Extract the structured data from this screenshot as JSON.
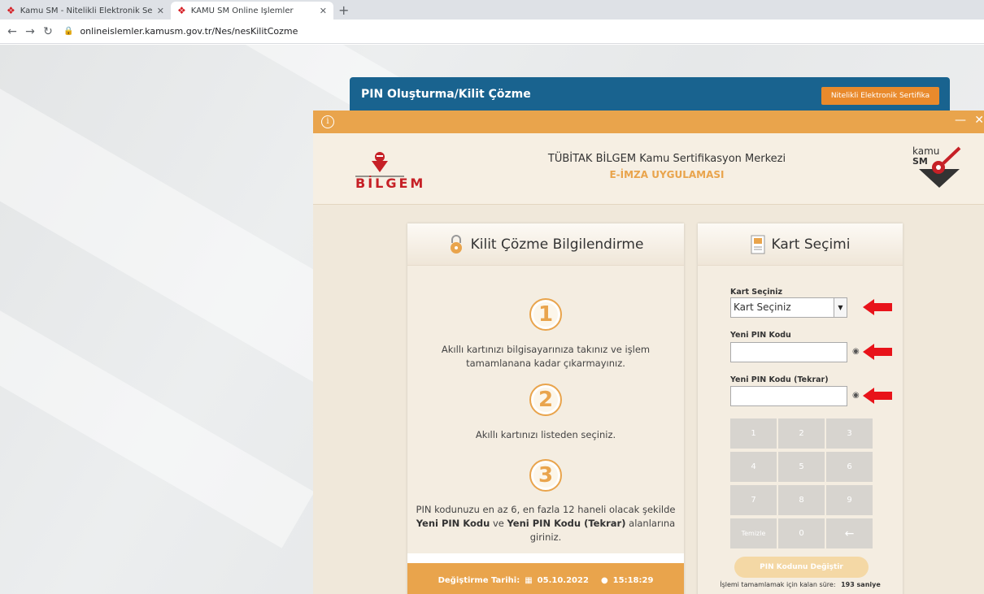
{
  "browser": {
    "tabs": [
      {
        "label": "Kamu SM - Nitelikli Elektronik Se",
        "active": false
      },
      {
        "label": "KAMU SM Online İşlemler",
        "active": true
      }
    ],
    "new_tab": "+",
    "url": "onlineislemler.kamusm.gov.tr/Nes/nesKilitCozme"
  },
  "page": {
    "title": "PIN Oluşturma/Kilit Çözme",
    "top_button": "Nitelikli Elektronik Sertifika"
  },
  "dialog": {
    "info": "i",
    "minimize": "—",
    "close": "✕",
    "logo_text": "BİLGEM",
    "header_title": "TÜBİTAK BİLGEM Kamu Sertifikasyon Merkezi",
    "header_subtitle": "E-İMZA UYGULAMASI",
    "info_panel": {
      "title": "Kilit Çözme Bilgilendirme",
      "steps": [
        {
          "number": "1",
          "text": "Akıllı kartınızı bilgisayarınıza takınız ve işlem tamamlanana kadar çıkarmayınız."
        },
        {
          "number": "2",
          "text": "Akıllı kartınızı listeden seçiniz."
        },
        {
          "number": "3",
          "text_before": "PIN kodunuzu en az 6, en fazla 12 haneli olacak şekilde",
          "bold1": "Yeni PIN Kodu",
          "mid": "ve",
          "bold2": "Yeni PIN Kodu (Tekrar)",
          "text_after": "alanlarına giriniz."
        }
      ],
      "footer_label": "Değiştirme Tarihi:",
      "footer_date": "05.10.2022",
      "footer_time": "15:18:29"
    },
    "card_panel": {
      "title": "Kart Seçimi",
      "select_label": "Kart Seçiniz",
      "select_value": "Kart Seçiniz",
      "pin_label": "Yeni PIN Kodu",
      "pin_value": "",
      "pin_repeat_label": "Yeni PIN Kodu (Tekrar)",
      "pin_repeat_value": "",
      "keypad": [
        "1",
        "2",
        "3",
        "4",
        "5",
        "6",
        "7",
        "8",
        "9",
        "Temizle",
        "0",
        "←"
      ],
      "submit": "PIN Kodunu Değiştir",
      "timer_label": "İşlemi tamamlamak için kalan süre:",
      "timer_value": "193 saniye"
    }
  },
  "colors": {
    "orange": "#e9a44c",
    "header_blue": "#19638f",
    "red_arrow": "#e8131a"
  }
}
